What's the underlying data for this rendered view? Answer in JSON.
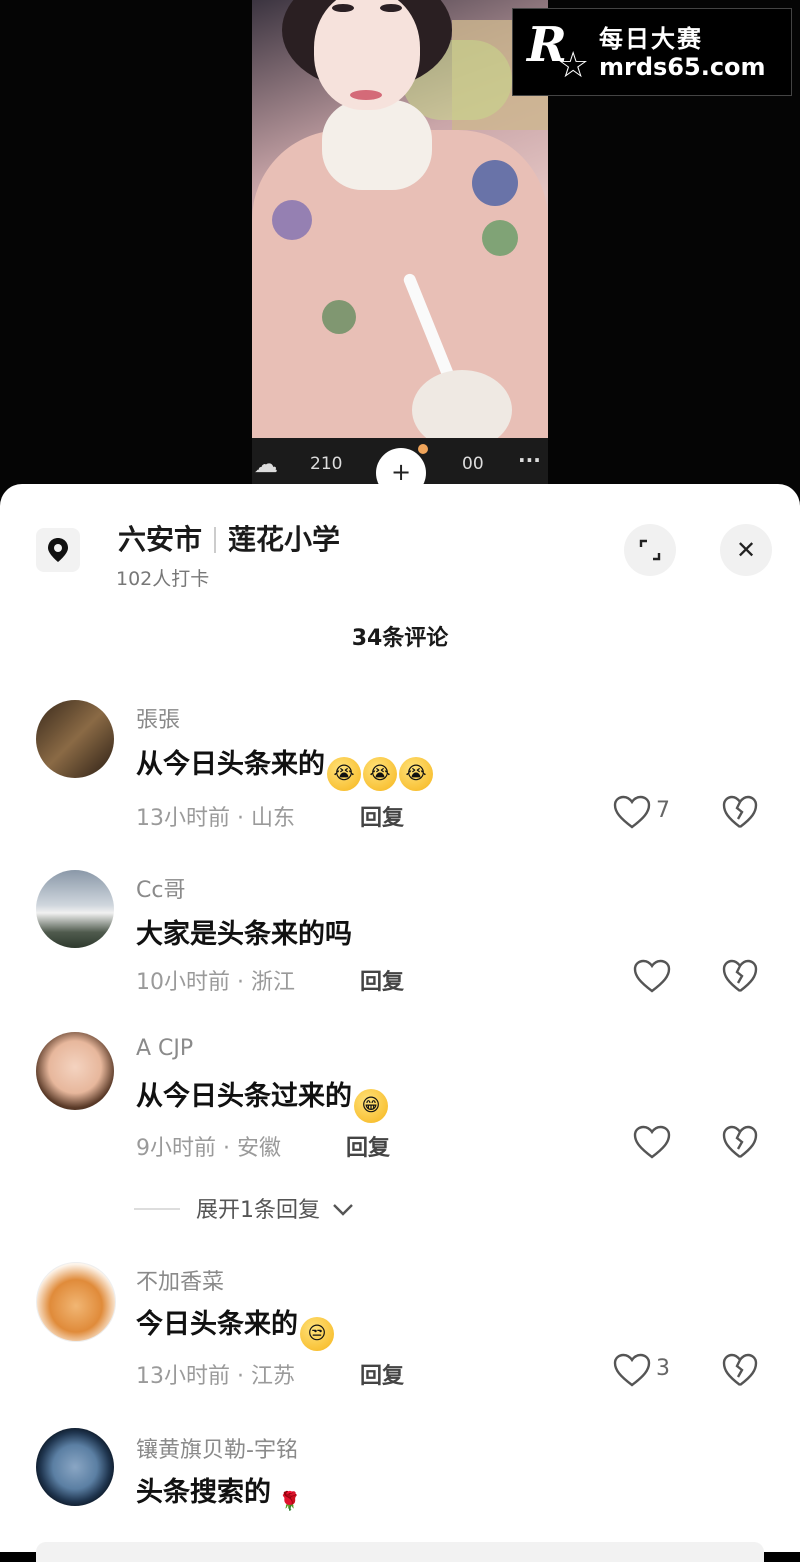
{
  "video": {
    "toolbar": {
      "count_left": "210",
      "plus_label": "+",
      "count_right": "00",
      "more_label": "···"
    },
    "watermark": {
      "logo_letter": "R",
      "star": "☆",
      "title": "每日大赛",
      "url": "mrds65.com"
    }
  },
  "location": {
    "city": "六安市",
    "place": "莲花小学",
    "checkins": "102人打卡",
    "expand_icon": "expand-icon",
    "close_icon": "close-icon",
    "close_label": "✕"
  },
  "comments_header": "34条评论",
  "comments": [
    {
      "name": "張張",
      "text": "从今日头条来的",
      "emoji": [
        "😭",
        "😭",
        "😭"
      ],
      "time": "13小时前 · 山东",
      "reply": "回复",
      "likes": "7"
    },
    {
      "name": "Cc哥",
      "text": "大家是头条来的吗",
      "emoji": [],
      "time": "10小时前 · 浙江",
      "reply": "回复",
      "likes": ""
    },
    {
      "name": "A CJP",
      "text": "从今日头条过来的",
      "emoji": [
        "😁"
      ],
      "time": "9小时前 · 安徽",
      "reply": "回复",
      "likes": "",
      "expand": "展开1条回复"
    },
    {
      "name": "不加香菜",
      "text": "今日头条来的",
      "emoji": [
        "😒"
      ],
      "time": "13小时前 · 江苏",
      "reply": "回复",
      "likes": "3"
    },
    {
      "name": "镶黄旗贝勒-宇铭",
      "text": "头条搜索的",
      "emoji": [
        "🌹"
      ]
    }
  ],
  "colors": {
    "sheet_bg": "#ffffff",
    "video_bg": "#050505",
    "meta_gray": "#9a9a9a"
  }
}
